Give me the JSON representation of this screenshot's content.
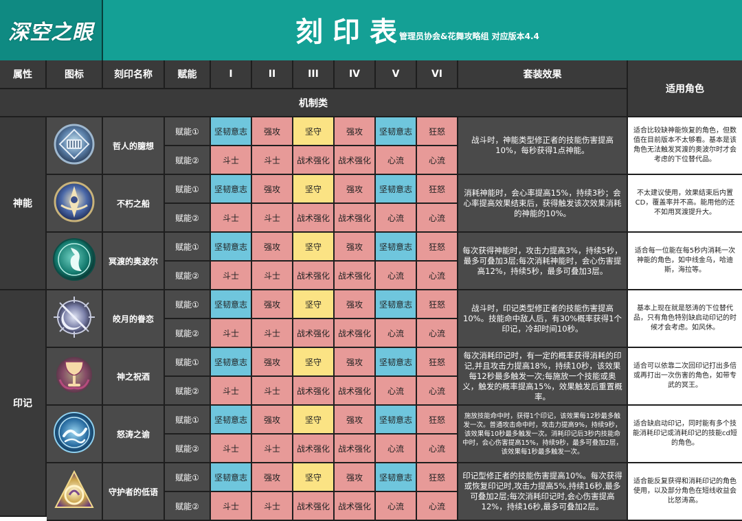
{
  "header": {
    "logo": "深空之眼",
    "title": "刻印表",
    "subtitle": "管理员协会&花舞攻略组 对应版本4.4"
  },
  "columns": {
    "attr": "属性",
    "icon": "图标",
    "name": "刻印名称",
    "slot": "赋能",
    "tiers": [
      "I",
      "II",
      "III",
      "IV",
      "V",
      "VI"
    ],
    "set": "套装效果",
    "role": "适用角色"
  },
  "section": "机制类",
  "categories": [
    {
      "label": "神能"
    },
    {
      "label": "印记"
    }
  ],
  "slot_labels": [
    "赋能①",
    "赋能②"
  ],
  "row1": [
    "坚韧意志",
    "强攻",
    "坚守",
    "强攻",
    "坚韧意志",
    "狂怒"
  ],
  "row2": [
    "斗士",
    "斗士",
    "战术强化",
    "战术强化",
    "心流",
    "心流"
  ],
  "colors": {
    "cyan": "#6fc6dd",
    "red": "#e79a98",
    "yellow": "#fbe384",
    "teal": "#14a095"
  },
  "items": [
    {
      "name": "哲人的臆想",
      "icon": "philosopher-emblem-icon",
      "set": "战斗时，神能类型修正者的技能伤害提高10%，每秒获得1点神能。",
      "role": "适合比较缺神能恢复的角色，但数值在目前版本不太够看。基本是该角色无法触发冥渡的奥波尔时才会考虑的下位替代品。"
    },
    {
      "name": "不朽之船",
      "icon": "immortal-ship-icon",
      "set": "消耗神能时，会心率提高15%，持续3秒；会心率提高效果结束后，获得触发该次效果消耗的神能的10%。",
      "role": "不太建议使用，效果结束后内置CD，覆盖率并不高。能用他的还不如用冥渡提升大。"
    },
    {
      "name": "冥渡的奥波尔",
      "icon": "obol-coin-icon",
      "set": "每次获得神能时，攻击力提高3%，持续5秒，最多可叠加3层;每次消耗神能时，会心伤害提高12%，持续5秒，最多可叠加3层。",
      "role": "适合每一位能在每5秒内消耗一次神能的角色，如中线金乌，哈迪斯，海拉等。"
    },
    {
      "name": "皎月的眷恋",
      "icon": "moon-arrow-icon",
      "set": "战斗时，印记类型修正者的技能伤害提高10%。技能命中敌人后，有30%概率获得1个印记，冷却时间10秒。",
      "role": "基本上现在就是怒涛的下位替代品，只有角色特别缺启动印记的时候才会考虑。如风休。"
    },
    {
      "name": "神之祝酒",
      "icon": "chalice-icon",
      "set": "每次消耗印记时，有一定的概率获得消耗的印记,并且攻击力提高18%，持续10秒，该效果每12秒最多触发一次;每施放一个技能或奥义，触发的概率提高15%，效果触发后重置概率。",
      "role": "适合可以依靠二次回印记打出多倍或再打出一次伤害的角色，如带专武的冥王。"
    },
    {
      "name": "怒涛之谕",
      "icon": "wave-seal-icon",
      "set": "施放技能命中时，获得1个印记，该效果每12秒最多触发一次。普通攻击命中时，攻击力提高9%，持续9秒，该效果每10秒最多触发一次。消耗印记后3秒内技能命中时，会心伤害提高15%，持续9秒，最多可叠加2层，该效果每1秒最多触发一次。",
      "role": "适合缺启动印记，同时能有多个技能消耗印记或消耗印记的技能cd短的角色。"
    },
    {
      "name": "守护者的低语",
      "icon": "guardian-arc-icon",
      "set": "印记型修正者的技能伤害提高10%。每次获得或恢复印记时,攻击力提高5%,持续16秒,最多可叠加2层;每次消耗印记时,会心伤害提高12%，持续16秒,最多可叠加2层。",
      "role": "适合能反复获得和消耗印记的角色使用，以及部分角色在短线收益会比怒涛高。"
    }
  ]
}
